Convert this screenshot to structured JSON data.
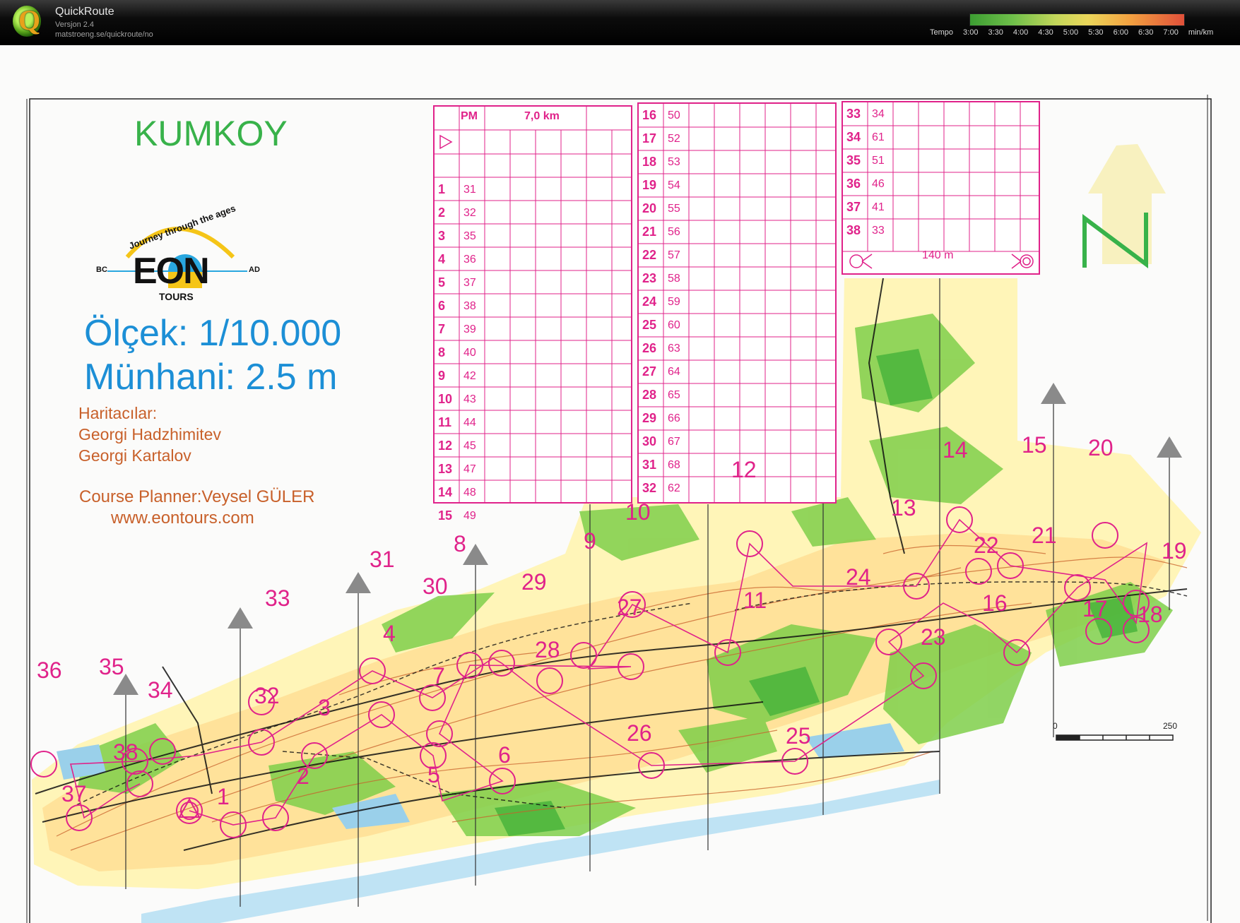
{
  "app": {
    "name": "QuickRoute",
    "version": "Versjon 2.4",
    "url": "matstroeng.se/quickroute/no"
  },
  "tempo": {
    "label": "Tempo",
    "ticks": [
      "3:00",
      "3:30",
      "4:00",
      "4:30",
      "5:00",
      "5:30",
      "6:00",
      "6:30",
      "7:00"
    ],
    "unit": "min/km"
  },
  "map": {
    "title": "KUMKOY",
    "logo": {
      "arc": "Journey through the ages",
      "word": "EON",
      "sub": "TOURS",
      "left": "BC",
      "right": "AD"
    },
    "scale": "Ölçek: 1/10.000",
    "contour": "Münhani: 2.5 m",
    "mappers_label": "Haritacılar:",
    "mapper1": "Georgi Hadzhimitev",
    "mapper2": "Georgi Kartalov",
    "planner": "Course Planner:Veysel GÜLER",
    "website": "www.eontours.com",
    "scalebar": {
      "start": "0",
      "end": "250"
    },
    "course": {
      "class": "PM",
      "length": "7,0 km",
      "finish": "140 m"
    },
    "descriptions": [
      [
        "1",
        "31"
      ],
      [
        "2",
        "32"
      ],
      [
        "3",
        "35"
      ],
      [
        "4",
        "36"
      ],
      [
        "5",
        "37"
      ],
      [
        "6",
        "38"
      ],
      [
        "7",
        "39"
      ],
      [
        "8",
        "40"
      ],
      [
        "9",
        "42"
      ],
      [
        "10",
        "43"
      ],
      [
        "11",
        "44"
      ],
      [
        "12",
        "45"
      ],
      [
        "13",
        "47"
      ],
      [
        "14",
        "48"
      ],
      [
        "15",
        "49"
      ],
      [
        "16",
        "50"
      ],
      [
        "17",
        "52"
      ],
      [
        "18",
        "53"
      ],
      [
        "19",
        "54"
      ],
      [
        "20",
        "55"
      ],
      [
        "21",
        "56"
      ],
      [
        "22",
        "57"
      ],
      [
        "23",
        "58"
      ],
      [
        "24",
        "59"
      ],
      [
        "25",
        "60"
      ],
      [
        "26",
        "63"
      ],
      [
        "27",
        "64"
      ],
      [
        "28",
        "65"
      ],
      [
        "29",
        "66"
      ],
      [
        "30",
        "67"
      ],
      [
        "31",
        "68"
      ],
      [
        "32",
        "62"
      ],
      [
        "33",
        "34"
      ],
      [
        "34",
        "61"
      ],
      [
        "35",
        "51"
      ],
      [
        "36",
        "46"
      ],
      [
        "37",
        "41"
      ],
      [
        "38",
        "33"
      ]
    ],
    "controls": [
      "1",
      "2",
      "3",
      "4",
      "5",
      "6",
      "7",
      "8",
      "9",
      "10",
      "11",
      "12",
      "13",
      "14",
      "15",
      "16",
      "17",
      "18",
      "19",
      "20",
      "21",
      "22",
      "23",
      "24",
      "25",
      "26",
      "27",
      "28",
      "29",
      "30",
      "31",
      "32",
      "33",
      "34",
      "35",
      "36",
      "37",
      "38"
    ],
    "colors": {
      "magenta": "#e0228a",
      "green": "#38b24a",
      "blue": "#1c8fd6",
      "brown": "#c8602a"
    }
  }
}
